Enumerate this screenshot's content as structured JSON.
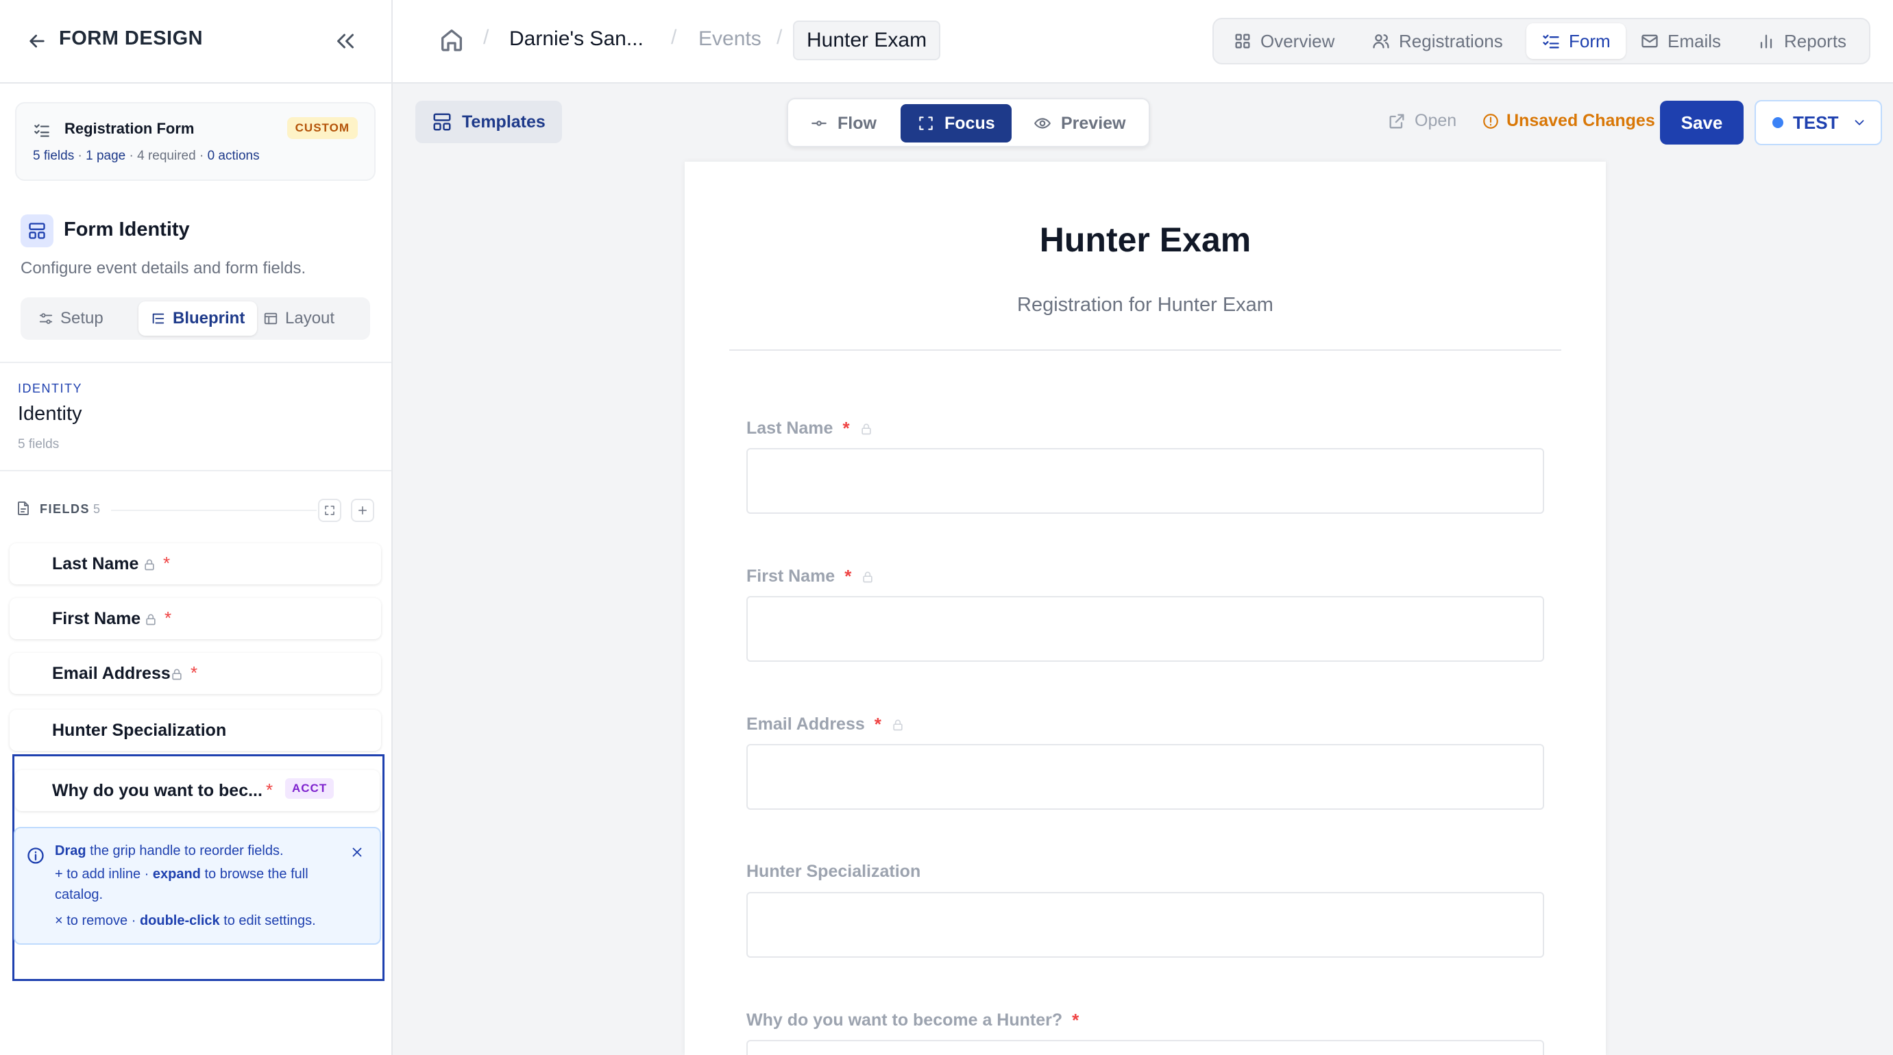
{
  "sidebar": {
    "title": "FORM DESIGN",
    "registration": {
      "name": "Registration Form",
      "badge": "CUSTOM",
      "fields_count": "5 fields",
      "dot1": " · ",
      "pages": "1 page",
      "dot2": " · ",
      "required": "4 required",
      "dot3": " · ",
      "actions": "0 actions"
    },
    "identity_section": {
      "title": "Form Identity",
      "description": "Configure event details and form fields."
    },
    "tabs": [
      {
        "label": "Setup"
      },
      {
        "label": "Blueprint"
      },
      {
        "label": "Layout"
      }
    ],
    "identity": {
      "kicker": "IDENTITY",
      "name": "Identity",
      "count": "5 fields"
    },
    "fields": {
      "label": "FIELDS",
      "count": "5",
      "items": [
        {
          "label": "Last Name",
          "required": "*"
        },
        {
          "label": "First Name",
          "required": "*"
        },
        {
          "label": "Email Address",
          "required": "*"
        },
        {
          "label": "Hunter Specialization"
        },
        {
          "label": "Why do you want to bec...",
          "required": "*",
          "tag": "ACCT"
        }
      ]
    },
    "tip": {
      "l1_bold": "Drag",
      "l1_rest": " the grip handle to reorder fields.",
      "l2_a": "+ to add inline · ",
      "l2_bold": "expand",
      "l2_rest": " to browse the full catalog.",
      "l3_a": "× to remove · ",
      "l3_bold": "double-click",
      "l3_rest": " to edit settings."
    }
  },
  "breadcrumb": {
    "items": [
      "Darnie's San...",
      "Events",
      "Hunter Exam"
    ],
    "separator": "/"
  },
  "nav": {
    "tabs": [
      {
        "label": "Overview",
        "icon": "grid-icon"
      },
      {
        "label": "Registrations",
        "icon": "users-icon"
      },
      {
        "label": "Form",
        "icon": "checklist-icon"
      },
      {
        "label": "Emails",
        "icon": "mail-icon"
      },
      {
        "label": "Reports",
        "icon": "bar-chart-icon"
      }
    ],
    "active": "Form"
  },
  "toolbar": {
    "templates_label": "Templates",
    "modes": [
      {
        "label": "Flow",
        "icon": "flow-icon"
      },
      {
        "label": "Focus",
        "icon": "focus-icon"
      },
      {
        "label": "Preview",
        "icon": "eye-icon"
      }
    ],
    "active_mode": "Focus",
    "open_label": "Open",
    "unsaved_label": "Unsaved Changes",
    "save_label": "Save",
    "env_label": "TEST"
  },
  "form": {
    "title": "Hunter Exam",
    "subtitle": "Registration for Hunter Exam",
    "questions": [
      {
        "label": "Last Name",
        "required": "*"
      },
      {
        "label": "First Name",
        "required": "*"
      },
      {
        "label": "Email Address",
        "required": "*"
      },
      {
        "label": "Hunter Specialization"
      },
      {
        "label": "Why do you want to become a Hunter?",
        "required": "*"
      }
    ]
  },
  "colors": {
    "brand": "#1e40af",
    "warning": "#d97706",
    "required": "#ef4444",
    "custom_badge": "#fef3c7",
    "acct_badge": "#f3e8ff"
  }
}
